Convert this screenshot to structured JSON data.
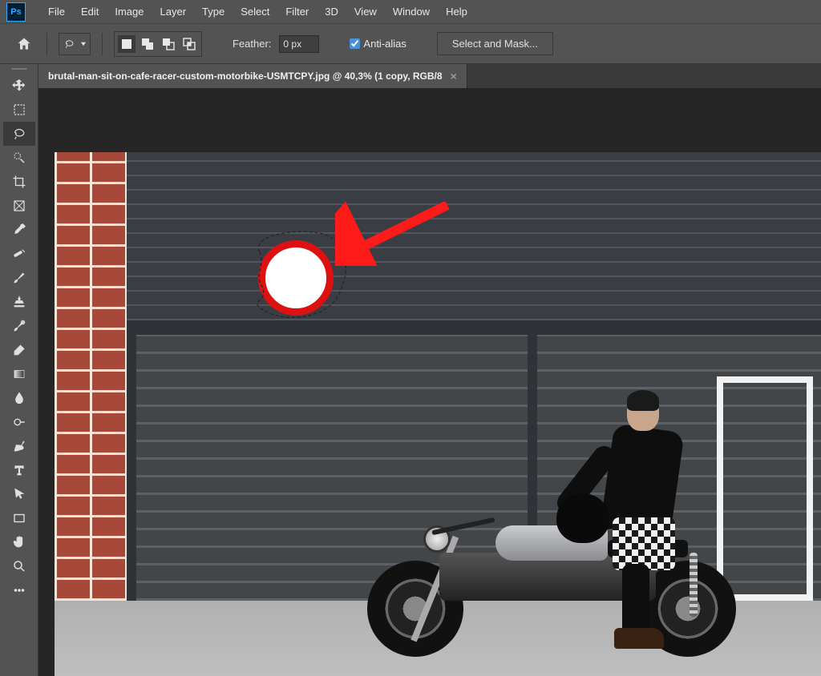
{
  "app": {
    "name": "Ps"
  },
  "menu": {
    "items": [
      "File",
      "Edit",
      "Image",
      "Layer",
      "Type",
      "Select",
      "Filter",
      "3D",
      "View",
      "Window",
      "Help"
    ]
  },
  "options_bar": {
    "feather_label": "Feather:",
    "feather_value": "0 px",
    "antialias_label": "Anti-alias",
    "antialias_checked": true,
    "select_and_mask": "Select and Mask..."
  },
  "document": {
    "tab_title": "brutal-man-sit-on-cafe-racer-custom-motorbike-USMTCPY.jpg @ 40,3% (1 copy, RGB/8",
    "zoom": "40,3%"
  },
  "tools": [
    {
      "id": "move",
      "label": "Move Tool"
    },
    {
      "id": "marquee",
      "label": "Rectangular Marquee Tool"
    },
    {
      "id": "lasso",
      "label": "Lasso Tool",
      "active": true
    },
    {
      "id": "magic-wand",
      "label": "Quick Selection Tool"
    },
    {
      "id": "crop",
      "label": "Crop Tool"
    },
    {
      "id": "frame",
      "label": "Frame Tool"
    },
    {
      "id": "eyedropper",
      "label": "Eyedropper Tool"
    },
    {
      "id": "healing",
      "label": "Spot Healing Brush Tool"
    },
    {
      "id": "brush",
      "label": "Brush Tool"
    },
    {
      "id": "stamp",
      "label": "Clone Stamp Tool"
    },
    {
      "id": "history-brush",
      "label": "History Brush Tool"
    },
    {
      "id": "eraser",
      "label": "Eraser Tool"
    },
    {
      "id": "gradient",
      "label": "Gradient Tool"
    },
    {
      "id": "blur",
      "label": "Blur Tool"
    },
    {
      "id": "dodge",
      "label": "Dodge Tool"
    },
    {
      "id": "pen",
      "label": "Pen Tool"
    },
    {
      "id": "type",
      "label": "Horizontal Type Tool"
    },
    {
      "id": "path-select",
      "label": "Path Selection Tool"
    },
    {
      "id": "rectangle",
      "label": "Rectangle Tool"
    },
    {
      "id": "hand",
      "label": "Hand Tool"
    },
    {
      "id": "zoom",
      "label": "Zoom Tool"
    },
    {
      "id": "more",
      "label": "Edit Toolbar"
    }
  ],
  "colors": {
    "accent": "#31a8ff",
    "panel": "#535353",
    "canvas_bg": "#262626",
    "arrow": "#ff1a1a"
  }
}
